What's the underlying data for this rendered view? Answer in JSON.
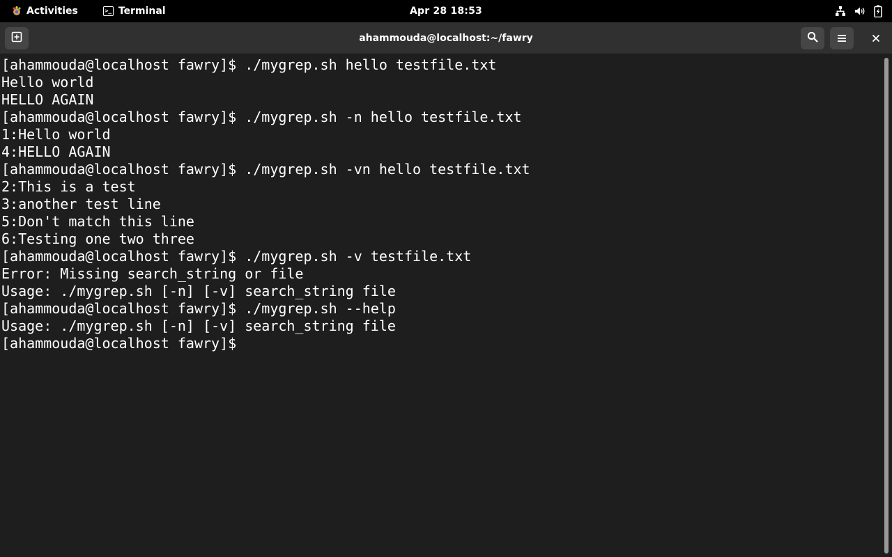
{
  "topbar": {
    "activities_label": "Activities",
    "app_label": "Terminal",
    "clock": "Apr 28  18:53"
  },
  "window": {
    "title": "ahammouda@localhost:~/fawry"
  },
  "terminal": {
    "lines": [
      "[ahammouda@localhost fawry]$ ./mygrep.sh hello testfile.txt",
      "Hello world",
      "HELLO AGAIN",
      "[ahammouda@localhost fawry]$ ./mygrep.sh -n hello testfile.txt",
      "1:Hello world",
      "4:HELLO AGAIN",
      "[ahammouda@localhost fawry]$ ./mygrep.sh -vn hello testfile.txt",
      "2:This is a test",
      "3:another test line",
      "5:Don't match this line",
      "6:Testing one two three",
      "[ahammouda@localhost fawry]$ ./mygrep.sh -v testfile.txt",
      "Error: Missing search_string or file",
      "Usage: ./mygrep.sh [-n] [-v] search_string file",
      "[ahammouda@localhost fawry]$ ./mygrep.sh --help",
      "Usage: ./mygrep.sh [-n] [-v] search_string file"
    ],
    "prompt": "[ahammouda@localhost fawry]$ "
  },
  "icons": {
    "activities": "gnome-logo-icon",
    "app": "terminal-icon",
    "network": "network-icon",
    "volume": "volume-icon",
    "battery": "battery-icon",
    "new_tab": "new-tab-icon",
    "search": "search-icon",
    "menu": "hamburger-menu-icon",
    "close": "close-icon"
  },
  "colors": {
    "topbar_bg": "#000000",
    "headerbar_bg": "#303030",
    "terminal_bg": "#1e1e1e",
    "text": "#ffffff"
  }
}
